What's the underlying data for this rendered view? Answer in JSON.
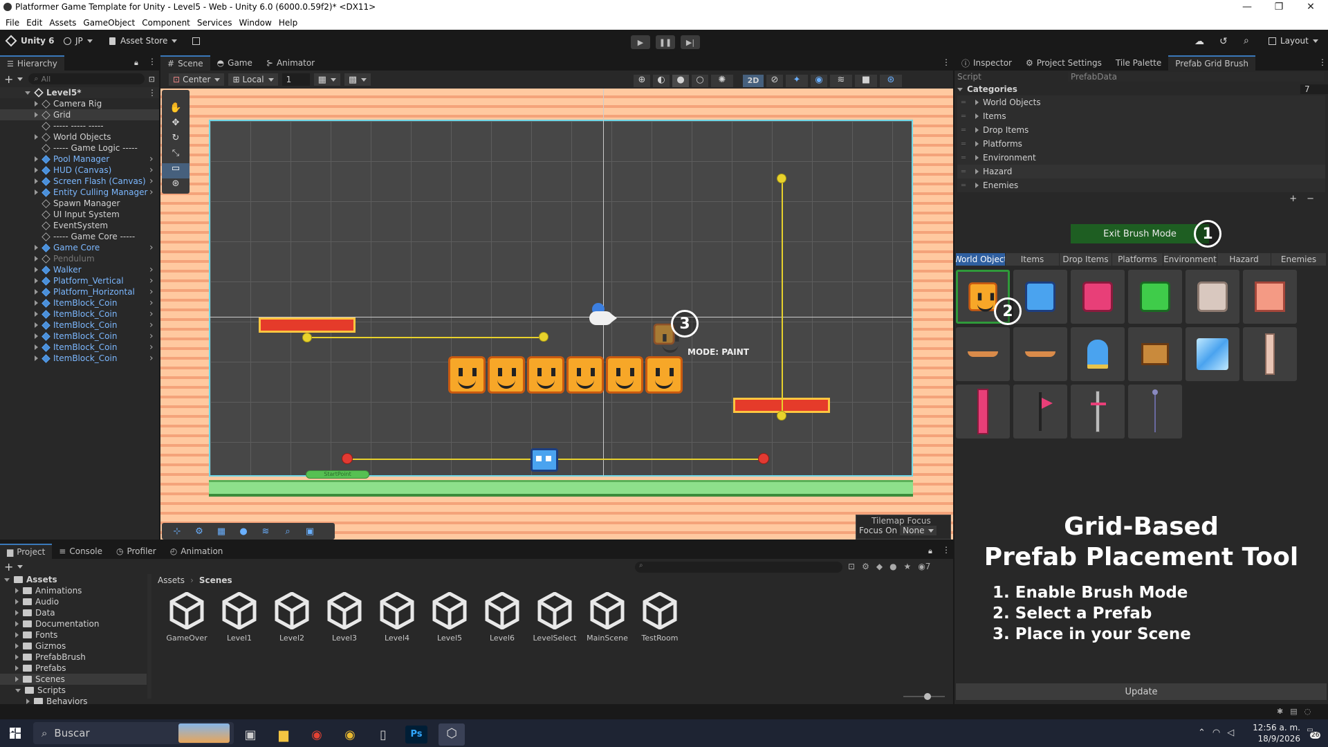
{
  "window": {
    "title": "Platformer Game Template for Unity - Level5 - Web - Unity 6.0 (6000.0.59f2)* <DX11>"
  },
  "menu": [
    "File",
    "Edit",
    "Assets",
    "GameObject",
    "Component",
    "Services",
    "Window",
    "Help"
  ],
  "toolbar": {
    "account": "Unity 6",
    "user": "JP",
    "asset_store": "Asset Store",
    "layout": "Layout"
  },
  "hierarchy": {
    "tab": "Hierarchy",
    "search_placeholder": "All",
    "root": "Level5*",
    "items": [
      {
        "label": "Camera Rig",
        "prefab": false
      },
      {
        "label": "Grid",
        "prefab": false
      },
      {
        "label": "----- ----- -----",
        "prefab": false
      },
      {
        "label": "World Objects",
        "prefab": false
      },
      {
        "label": "----- Game Logic -----",
        "prefab": false
      },
      {
        "label": "Pool Manager",
        "prefab": true
      },
      {
        "label": "HUD (Canvas)",
        "prefab": true
      },
      {
        "label": "Screen Flash (Canvas)",
        "prefab": true
      },
      {
        "label": "Entity Culling Manager",
        "prefab": true
      },
      {
        "label": "Spawn Manager",
        "prefab": false
      },
      {
        "label": "UI Input System",
        "prefab": false
      },
      {
        "label": "EventSystem",
        "prefab": false
      },
      {
        "label": "----- Game Core -----",
        "prefab": false
      },
      {
        "label": "Game Core",
        "prefab": true
      },
      {
        "label": "Pendulum",
        "prefab": false
      },
      {
        "label": "Walker",
        "prefab": true
      },
      {
        "label": "Platform_Vertical",
        "prefab": true
      },
      {
        "label": "Platform_Horizontal",
        "prefab": true
      },
      {
        "label": "ItemBlock_Coin",
        "prefab": true
      },
      {
        "label": "ItemBlock_Coin",
        "prefab": true
      },
      {
        "label": "ItemBlock_Coin",
        "prefab": true
      },
      {
        "label": "ItemBlock_Coin",
        "prefab": true
      },
      {
        "label": "ItemBlock_Coin",
        "prefab": true
      },
      {
        "label": "ItemBlock_Coin",
        "prefab": true
      }
    ]
  },
  "scene_view": {
    "tabs": [
      "Scene",
      "Game",
      "Animator"
    ],
    "pivot": "Center",
    "space": "Local",
    "grid_value": "1",
    "mode_2d": "2D",
    "mode_label": "MODE: PAINT",
    "start_label": "StartPoint",
    "tilemap_focus_title": "Tilemap Focus",
    "focus_on_label": "Focus On",
    "focus_on_value": "None",
    "callout_1": "1",
    "callout_2": "2",
    "callout_3": "3"
  },
  "right_panel": {
    "tabs": [
      "Inspector",
      "Project Settings",
      "Tile Palette",
      "Prefab Grid Brush"
    ],
    "script_label": "Script",
    "script_value": "PrefabData",
    "categories_label": "Categories",
    "categories_count": "7",
    "categories": [
      "World Objects",
      "Items",
      "Drop Items",
      "Platforms",
      "Environment",
      "Hazard",
      "Enemies"
    ],
    "exit_button": "Exit Brush Mode",
    "palette_tabs": [
      "World Object",
      "Items",
      "Drop Items",
      "Platforms",
      "Environment",
      "Hazard",
      "Enemies"
    ],
    "promo_title_1": "Grid-Based",
    "promo_title_2": "Prefab Placement Tool",
    "steps": [
      "1. Enable Brush Mode",
      "2. Select a Prefab",
      "3. Place in your Scene"
    ],
    "update_button": "Update"
  },
  "project": {
    "tabs": [
      "Project",
      "Console",
      "Profiler",
      "Animation"
    ],
    "tree": [
      {
        "label": "Assets",
        "level": 0,
        "open": true
      },
      {
        "label": "Animations",
        "level": 1
      },
      {
        "label": "Audio",
        "level": 1
      },
      {
        "label": "Data",
        "level": 1
      },
      {
        "label": "Documentation",
        "level": 1
      },
      {
        "label": "Fonts",
        "level": 1
      },
      {
        "label": "Gizmos",
        "level": 1
      },
      {
        "label": "PrefabBrush",
        "level": 1
      },
      {
        "label": "Prefabs",
        "level": 1
      },
      {
        "label": "Scenes",
        "level": 1
      },
      {
        "label": "Scripts",
        "level": 1,
        "open": true
      },
      {
        "label": "Behaviors",
        "level": 2
      }
    ],
    "breadcrumb_root": "Assets",
    "breadcrumb_current": "Scenes",
    "files": [
      "GameOver",
      "Level1",
      "Level2",
      "Level3",
      "Level4",
      "Level5",
      "Level6",
      "LevelSelect",
      "MainScene",
      "TestRoom"
    ],
    "hidden_count": "7"
  },
  "taskbar": {
    "search_placeholder": "Buscar",
    "time": "12:56 a. m.",
    "date": "18/9/2026",
    "notifications": "26"
  }
}
